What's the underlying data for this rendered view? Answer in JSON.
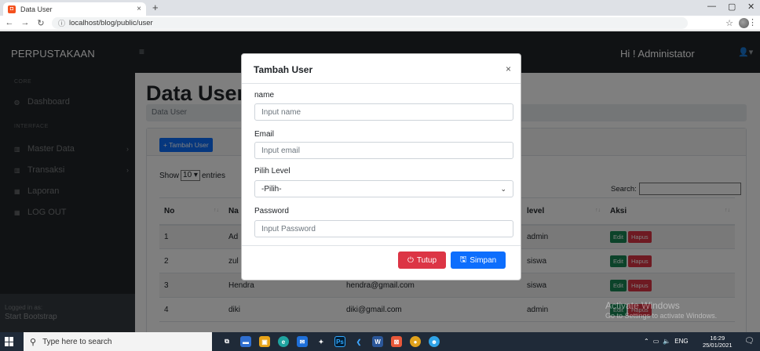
{
  "browser": {
    "tab_title": "Data User",
    "tab_close": "×",
    "new_tab": "+",
    "url": "localhost/blog/public/user",
    "win_min": "—",
    "win_max": "▢",
    "win_close": "✕"
  },
  "navbar": {
    "brand": "PERPUSTAKAAN",
    "greeting": "Hi ! Administator"
  },
  "sidebar": {
    "head_core": "CORE",
    "dashboard": "Dashboard",
    "head_interface": "INTERFACE",
    "master_data": "Master Data",
    "transaksi": "Transaksi",
    "laporan": "Laporan",
    "logout": "LOG OUT",
    "footer_small": "Logged in as:",
    "footer_big": "Start Bootstrap"
  },
  "page": {
    "title": "Data User",
    "breadcrumb": "Data User",
    "add_button": "+ Tambah User",
    "show_prefix": "Show",
    "show_value": "10",
    "show_suffix": "entries",
    "search_label": "Search:"
  },
  "table": {
    "headers": {
      "no": "No",
      "name": "Na",
      "level": "level",
      "aksi": "Aksi"
    },
    "rows": [
      {
        "no": "1",
        "name": "Ad",
        "email": "",
        "level": "admin"
      },
      {
        "no": "2",
        "name": "zul",
        "email": "",
        "level": "siswa"
      },
      {
        "no": "3",
        "name": "Hendra",
        "email": "hendra@gmail.com",
        "level": "siswa"
      },
      {
        "no": "4",
        "name": "diki",
        "email": "diki@gmail.com",
        "level": "admin"
      }
    ],
    "edit_label": "Edit",
    "delete_label": "Hapus"
  },
  "modal": {
    "title": "Tambah User",
    "close": "×",
    "name_label": "name",
    "name_placeholder": "Input name",
    "email_label": "Email",
    "email_placeholder": "Input email",
    "level_label": "Pilih Level",
    "level_value": "-Pilih-",
    "password_label": "Password",
    "password_placeholder": "Input Password",
    "tutup": "Tutup",
    "simpan": "Simpan"
  },
  "watermark": {
    "line1": "Activate Windows",
    "line2": "Go to Settings to activate Windows."
  },
  "taskbar": {
    "search_placeholder": "Type here to search",
    "lang": "ENG",
    "time": "16:29",
    "date": "25/01/2021"
  },
  "colors": {
    "primary": "#0d6efd",
    "danger": "#dc3545",
    "success": "#198754",
    "dark": "#212529"
  }
}
